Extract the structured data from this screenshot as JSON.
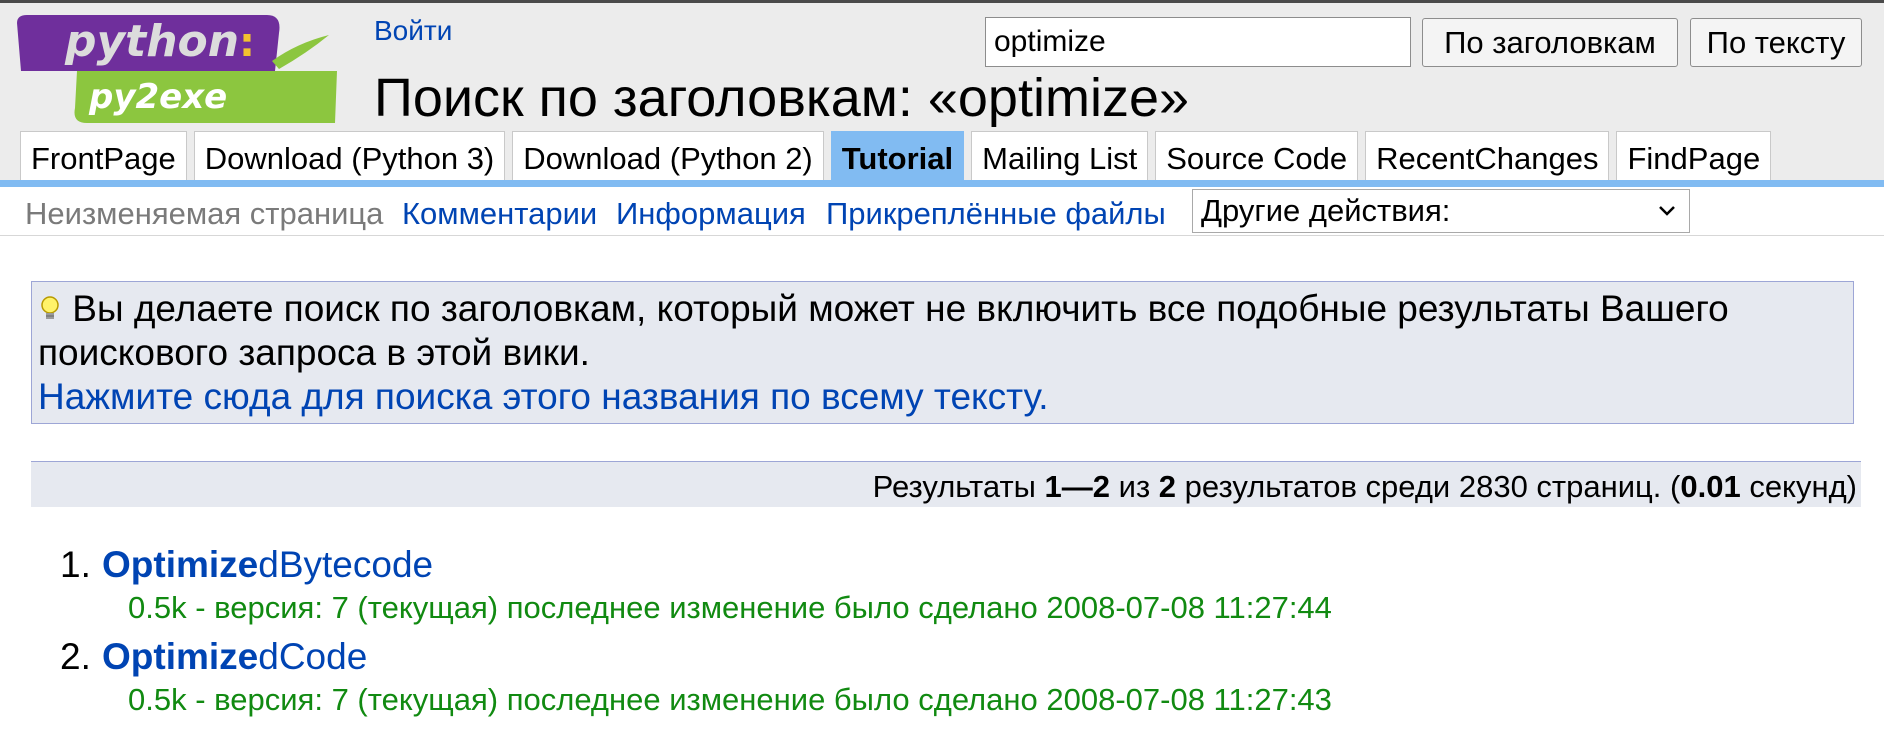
{
  "header": {
    "logo": {
      "top_text": "python",
      "bottom_text": "py2exe",
      "icon": "python-py2exe-logo"
    },
    "login_label": "Войти",
    "title": "Поиск по заголовкам: «optimize»"
  },
  "search": {
    "value": "optimize",
    "title_button": "По заголовкам",
    "text_button": "По тексту"
  },
  "navbar": {
    "items": [
      {
        "label": "FrontPage",
        "current": false
      },
      {
        "label": "Download (Python 3)",
        "current": false
      },
      {
        "label": "Download (Python 2)",
        "current": false
      },
      {
        "label": "Tutorial",
        "current": true
      },
      {
        "label": "Mailing List",
        "current": false
      },
      {
        "label": "Source Code",
        "current": false
      },
      {
        "label": "RecentChanges",
        "current": false
      },
      {
        "label": "FindPage",
        "current": false
      }
    ]
  },
  "actions": {
    "immutable": "Неизменяемая страница",
    "comments": "Комментарии",
    "info": "Информация",
    "attachments": "Прикреплённые файлы",
    "more_actions": "Другие действия:"
  },
  "notice": {
    "icon": "lightbulb-icon",
    "text": "Вы делаете поиск по заголовкам, который может не включить все подобные результаты Вашего поискового запроса в этой вики.",
    "link": "Нажмите сюда для поиска этого названия по всему тексту."
  },
  "stats": {
    "prefix": "Результаты ",
    "range": "1—2",
    "of": " из ",
    "total": "2",
    "middle": " результатов среди 2830 страниц. (",
    "time": "0.01",
    "suffix": " секунд)"
  },
  "results": [
    {
      "number": "1.",
      "match": "Optimize",
      "rest": "dBytecode",
      "meta": "0.5k - версия: 7 (текущая) последнее изменение было сделано 2008-07-08 11:27:44"
    },
    {
      "number": "2.",
      "match": "Optimize",
      "rest": "dCode",
      "meta": "0.5k - версия: 7 (текущая) последнее изменение было сделано 2008-07-08 11:27:43"
    }
  ],
  "colors": {
    "link": "#0044b3",
    "tab_current": "#81bbf2",
    "panel_bg": "#e6e9f0",
    "result_meta": "#118a11",
    "logo_purple": "#6f2f9c",
    "logo_green": "#8cc63f"
  }
}
